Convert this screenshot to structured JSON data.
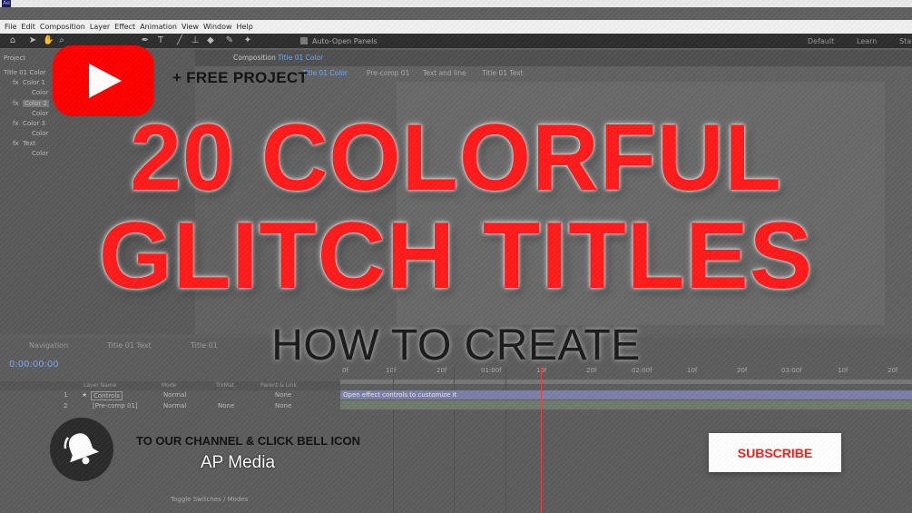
{
  "window": {
    "app_icon": "Ae"
  },
  "menu": [
    "File",
    "Edit",
    "Composition",
    "Layer",
    "Effect",
    "Animation",
    "View",
    "Window",
    "Help"
  ],
  "toolbar": {
    "icons": [
      "home-icon",
      "selection-arrow-icon",
      "hand-icon",
      "zoom-icon",
      "camera-icon",
      "pan-icon",
      "rectangle-icon",
      "pen-icon",
      "type-icon",
      "brush-icon",
      "stamp-icon",
      "eraser-icon",
      "puppet-icon"
    ],
    "auto_open": "Auto-Open Panels",
    "workspaces": [
      "Default",
      "Learn",
      "Stan"
    ]
  },
  "left_panel": {
    "tab": "Project",
    "header": "Title 01 Color",
    "effects": [
      {
        "label": "Color 1",
        "sub": "Color"
      },
      {
        "label": "Color 2",
        "sub": "Color"
      },
      {
        "label": "Color 3",
        "sub": "Color"
      },
      {
        "label": "Text",
        "sub": "Color"
      }
    ]
  },
  "composition": {
    "title_prefix": "Composition",
    "title_name": "Title 01 Color",
    "tabs": [
      "Title 01 Color",
      "Pre-comp 01",
      "Text and line",
      "Title 01 Text"
    ]
  },
  "timeline": {
    "tabs": [
      "Navigation",
      "Title 01 Text",
      "Title 01"
    ],
    "timecode": "0:00:00:00",
    "columns": [
      "Layer Name",
      "Mode",
      "TrkMat",
      "Parent & Link"
    ],
    "layers": [
      {
        "num": "1",
        "name": "Controls",
        "mode": "Normal",
        "parent": "None"
      },
      {
        "num": "2",
        "name": "[Pre-comp 01]",
        "mode": "Normal",
        "trkmat": "None",
        "parent": "None"
      }
    ],
    "track_label": "Open effect controls to customize it",
    "ruler": [
      "0f",
      "10f",
      "20f",
      "01:00f",
      "10f",
      "20f",
      "02:00f",
      "10f",
      "20f",
      "03:00f",
      "10f",
      "20f"
    ],
    "toggle": "Toggle Switches / Modes"
  },
  "overlay": {
    "free_project": "+ FREE PROJECT",
    "headline_line1": "20 COLORFUL",
    "headline_line2": "GLITCH TITLES",
    "subhead": "HOW TO CREATE",
    "channel_cta": "TO OUR CHANNEL & CLICK BELL ICON",
    "channel_name": "AP Media",
    "subscribe_label": "SUBSCRIBE",
    "play_icon": "play-button-icon",
    "bell_icon": "bell-icon"
  },
  "colors": {
    "accent_red": "#ff1a1a",
    "youtube_red": "#ff0000",
    "timecode_blue": "#6da9ff"
  }
}
